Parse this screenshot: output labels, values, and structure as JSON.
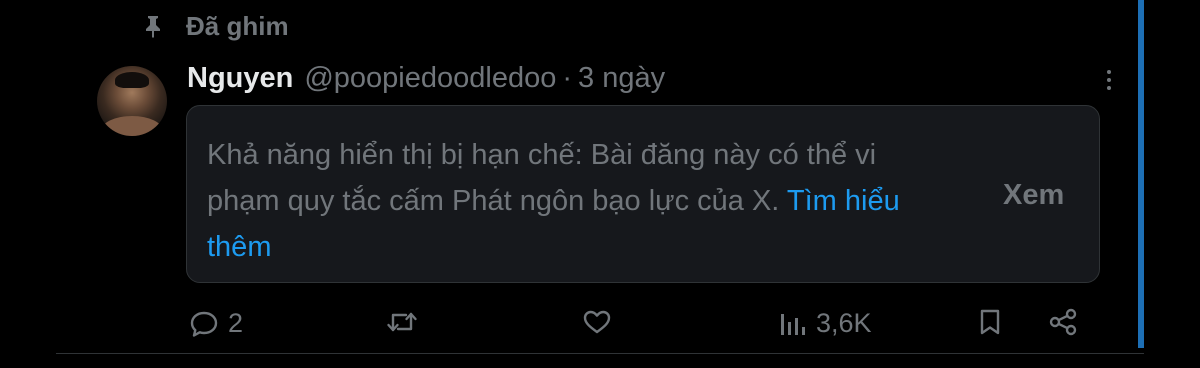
{
  "pinned": {
    "icon": "pin-icon",
    "label": "Đã ghim"
  },
  "post": {
    "author_name": "Nguyen",
    "handle": "@poopiedoodledoo",
    "separator": "·",
    "time": "3 ngày",
    "notice": {
      "text": "Khả năng hiển thị bị hạn chế: Bài đăng này có thể vi phạm quy tắc cấm Phát ngôn bạo lực của X.",
      "link_text": "Tìm hiểu thêm",
      "view_label": "Xem"
    }
  },
  "actions": {
    "reply_count": "2",
    "views_count": "3,6K"
  },
  "colors": {
    "background": "#000000",
    "text_primary": "#e7e9ea",
    "text_secondary": "#71767b",
    "link": "#1d9bf0",
    "notice_bg": "#16181c",
    "accent_bar": "#1d6fb5"
  }
}
